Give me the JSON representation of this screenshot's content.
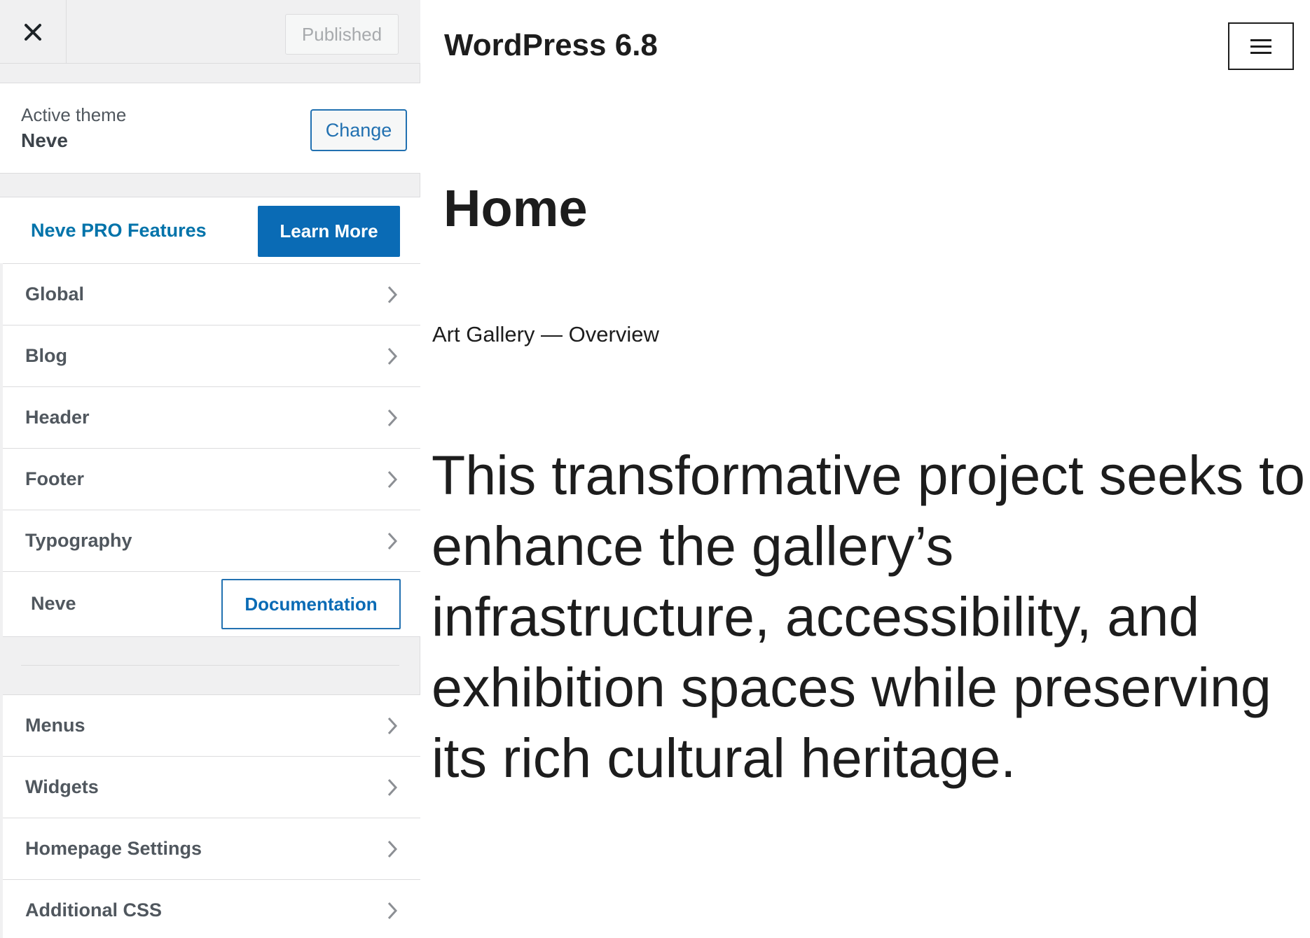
{
  "sidebar": {
    "published_label": "Published",
    "active_theme_label": "Active theme",
    "theme_name": "Neve",
    "change_label": "Change",
    "pro_features_label": "Neve PRO Features",
    "learn_more_label": "Learn More",
    "sections_a": [
      {
        "label": "Global"
      },
      {
        "label": "Blog"
      },
      {
        "label": "Header"
      },
      {
        "label": "Footer"
      },
      {
        "label": "Typography"
      }
    ],
    "doc_label": "Neve",
    "documentation_label": "Documentation",
    "sections_b": [
      {
        "label": "Menus"
      },
      {
        "label": "Widgets"
      },
      {
        "label": "Homepage Settings"
      },
      {
        "label": "Additional CSS"
      }
    ]
  },
  "preview": {
    "site_title": "WordPress 6.8",
    "page_heading": "Home",
    "subtitle": "Art Gallery — Overview",
    "body_text": "This transformative project seeks to enhance the gallery’s infrastructure, accessibility, and exhibition spaces while preserving its rich cultural heritage."
  },
  "icons": {
    "close": "close-icon",
    "chevron": "chevron-right-icon",
    "menu": "hamburger-menu-icon"
  },
  "colors": {
    "accent": "#2271b1",
    "primary_button": "#0a6bb5",
    "link": "#0073aa"
  }
}
